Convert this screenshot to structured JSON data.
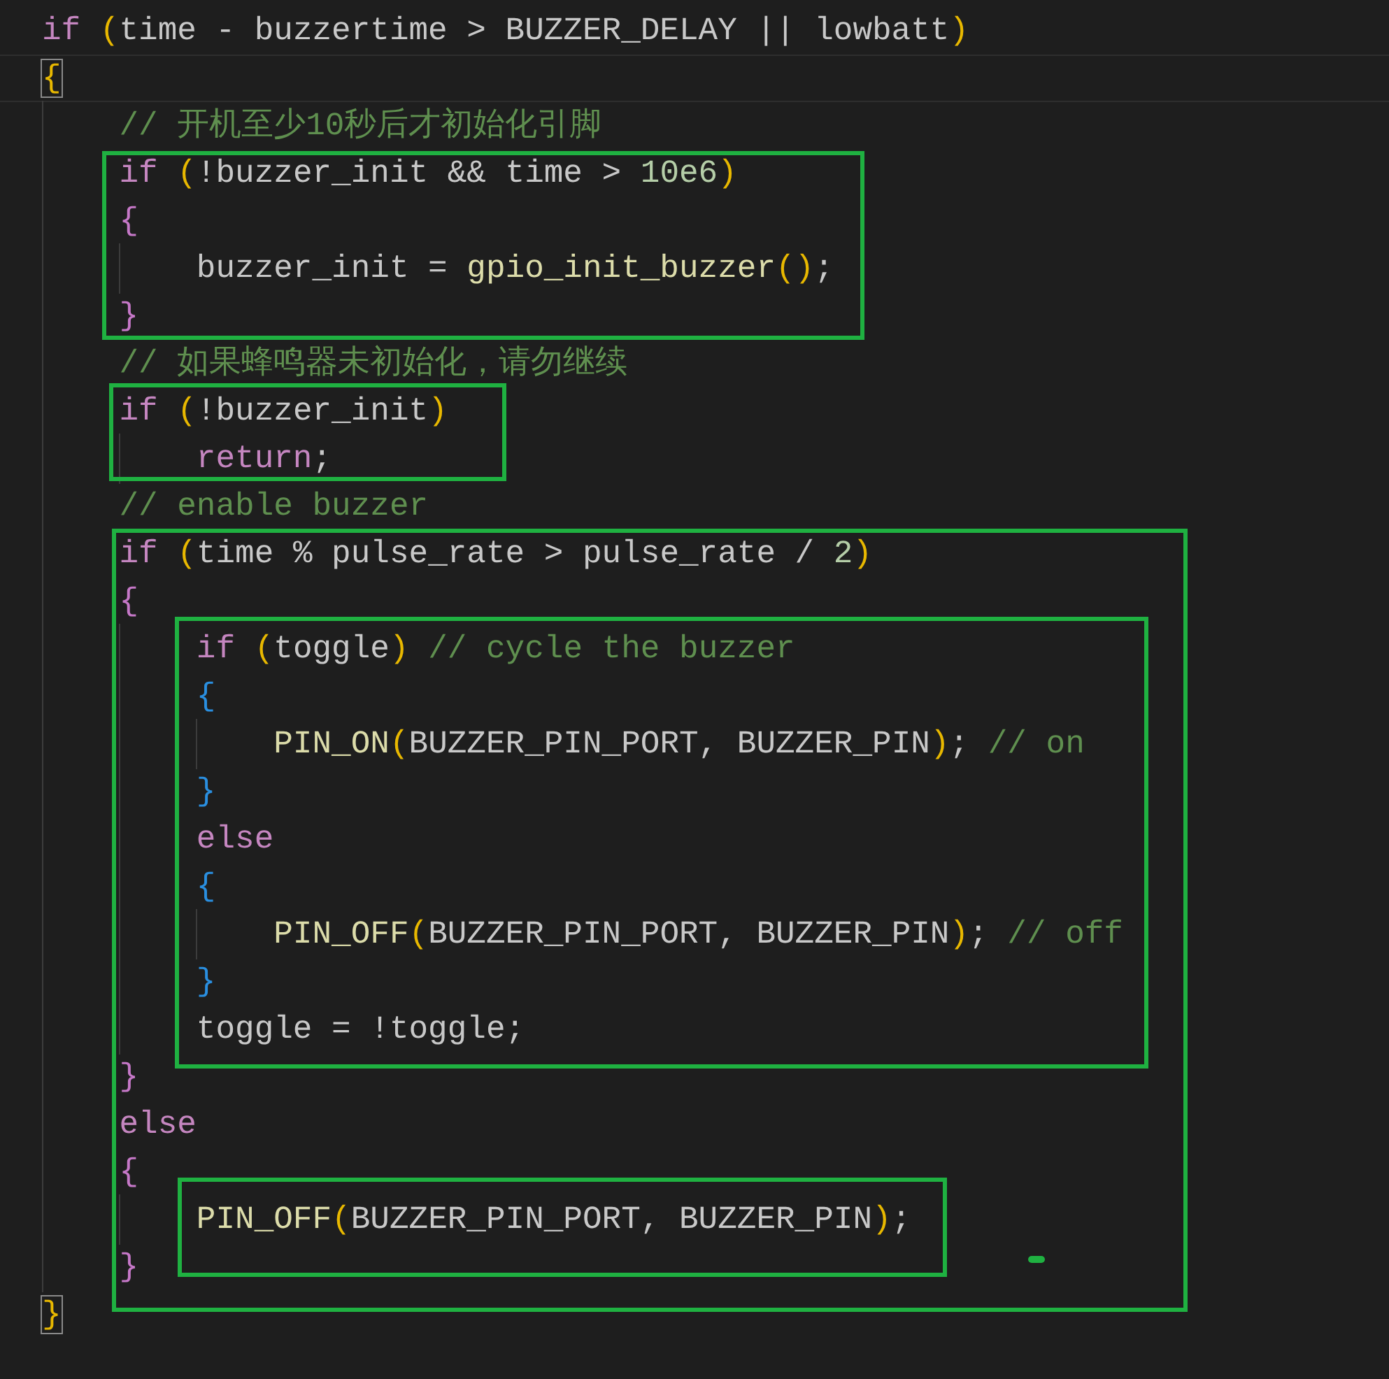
{
  "editor": {
    "lines": [
      {
        "current": false,
        "tokens": [
          {
            "kind": "keyword",
            "text": "if"
          },
          {
            "kind": "paren",
            "text": " ("
          },
          {
            "kind": "plain",
            "text": "time - buzzertime > BUZZER_DELAY || lowbatt"
          },
          {
            "kind": "paren",
            "text": ")"
          }
        ]
      },
      {
        "current": true,
        "tokens": [
          {
            "kind": "brace1",
            "text": "{",
            "matched": true
          }
        ]
      },
      {
        "current": false,
        "tokens": [
          {
            "kind": "comment",
            "text": "    // 开机至少10秒后才初始化引脚"
          }
        ]
      },
      {
        "current": false,
        "tokens": [
          {
            "kind": "keyword",
            "text": "    if"
          },
          {
            "kind": "paren",
            "text": " ("
          },
          {
            "kind": "plain",
            "text": "!buzzer_init && time > "
          },
          {
            "kind": "number",
            "text": "10e6"
          },
          {
            "kind": "paren",
            "text": ")"
          }
        ]
      },
      {
        "current": false,
        "tokens": [
          {
            "kind": "brace2",
            "text": "    {"
          }
        ]
      },
      {
        "current": false,
        "tokens": [
          {
            "kind": "plain",
            "text": "        buzzer_init = "
          },
          {
            "kind": "function",
            "text": "gpio_init_buzzer"
          },
          {
            "kind": "paren",
            "text": "()"
          },
          {
            "kind": "plain",
            "text": ";"
          }
        ]
      },
      {
        "current": false,
        "tokens": [
          {
            "kind": "brace2",
            "text": "    }"
          }
        ]
      },
      {
        "current": false,
        "tokens": [
          {
            "kind": "comment",
            "text": "    // 如果蜂鸣器未初始化，请勿继续"
          }
        ]
      },
      {
        "current": false,
        "tokens": [
          {
            "kind": "keyword",
            "text": "    if"
          },
          {
            "kind": "paren",
            "text": " ("
          },
          {
            "kind": "plain",
            "text": "!buzzer_init"
          },
          {
            "kind": "paren",
            "text": ")"
          }
        ]
      },
      {
        "current": false,
        "tokens": [
          {
            "kind": "keyword",
            "text": "        return"
          },
          {
            "kind": "plain",
            "text": ";"
          }
        ]
      },
      {
        "current": false,
        "tokens": [
          {
            "kind": "comment",
            "text": "    // enable buzzer"
          }
        ]
      },
      {
        "current": false,
        "tokens": [
          {
            "kind": "keyword",
            "text": "    if"
          },
          {
            "kind": "paren",
            "text": " ("
          },
          {
            "kind": "plain",
            "text": "time % pulse_rate > pulse_rate / "
          },
          {
            "kind": "number",
            "text": "2"
          },
          {
            "kind": "paren",
            "text": ")"
          }
        ]
      },
      {
        "current": false,
        "tokens": [
          {
            "kind": "brace2",
            "text": "    {"
          }
        ]
      },
      {
        "current": false,
        "tokens": [
          {
            "kind": "keyword",
            "text": "        if"
          },
          {
            "kind": "paren",
            "text": " ("
          },
          {
            "kind": "plain",
            "text": "toggle"
          },
          {
            "kind": "paren",
            "text": ")"
          },
          {
            "kind": "comment",
            "text": " // cycle the buzzer"
          }
        ]
      },
      {
        "current": false,
        "tokens": [
          {
            "kind": "brace3",
            "text": "        {"
          }
        ]
      },
      {
        "current": false,
        "tokens": [
          {
            "kind": "function",
            "text": "            PIN_ON"
          },
          {
            "kind": "paren",
            "text": "("
          },
          {
            "kind": "plain",
            "text": "BUZZER_PIN_PORT, BUZZER_PIN"
          },
          {
            "kind": "paren",
            "text": ")"
          },
          {
            "kind": "plain",
            "text": ";"
          },
          {
            "kind": "comment",
            "text": " // on"
          }
        ]
      },
      {
        "current": false,
        "tokens": [
          {
            "kind": "brace3",
            "text": "        }"
          }
        ]
      },
      {
        "current": false,
        "tokens": [
          {
            "kind": "keyword",
            "text": "        else"
          }
        ]
      },
      {
        "current": false,
        "tokens": [
          {
            "kind": "brace3",
            "text": "        {"
          }
        ]
      },
      {
        "current": false,
        "tokens": [
          {
            "kind": "function",
            "text": "            PIN_OFF"
          },
          {
            "kind": "paren",
            "text": "("
          },
          {
            "kind": "plain",
            "text": "BUZZER_PIN_PORT, BUZZER_PIN"
          },
          {
            "kind": "paren",
            "text": ")"
          },
          {
            "kind": "plain",
            "text": ";"
          },
          {
            "kind": "comment",
            "text": " // off"
          }
        ]
      },
      {
        "current": false,
        "tokens": [
          {
            "kind": "brace3",
            "text": "        }"
          }
        ]
      },
      {
        "current": false,
        "tokens": [
          {
            "kind": "plain",
            "text": "        toggle = !toggle;"
          }
        ]
      },
      {
        "current": false,
        "tokens": [
          {
            "kind": "brace2",
            "text": "    }"
          }
        ]
      },
      {
        "current": false,
        "tokens": [
          {
            "kind": "keyword",
            "text": "    else"
          }
        ]
      },
      {
        "current": false,
        "tokens": [
          {
            "kind": "brace2",
            "text": "    {"
          }
        ]
      },
      {
        "current": false,
        "tokens": [
          {
            "kind": "function",
            "text": "        PIN_OFF"
          },
          {
            "kind": "paren",
            "text": "("
          },
          {
            "kind": "plain",
            "text": "BUZZER_PIN_PORT, BUZZER_PIN"
          },
          {
            "kind": "paren",
            "text": ")"
          },
          {
            "kind": "plain",
            "text": ";"
          }
        ]
      },
      {
        "current": false,
        "tokens": [
          {
            "kind": "brace2",
            "text": "    }"
          }
        ]
      },
      {
        "current": false,
        "tokens": [
          {
            "kind": "brace1",
            "text": "}",
            "matched": true
          }
        ]
      }
    ]
  },
  "annotations": [
    {
      "kind": "outline"
    },
    {
      "kind": "outline"
    },
    {
      "kind": "outline"
    },
    {
      "kind": "outline"
    },
    {
      "kind": "outline"
    },
    {
      "kind": "dash"
    }
  ]
}
